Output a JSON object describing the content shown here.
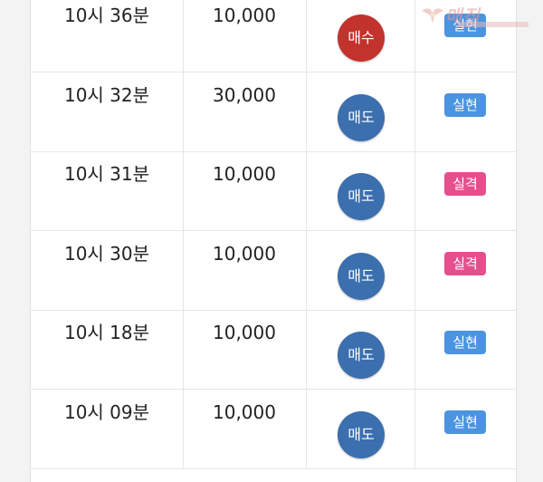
{
  "colors": {
    "sell": "#3b6fae",
    "buy": "#c2332e",
    "realized": "#4a94e0",
    "failed": "#e44f8c"
  },
  "watermark": {
    "text": "매직"
  },
  "rows": [
    {
      "time": "10시 36분",
      "amount": "10,000",
      "trade": "매수",
      "trade_type": "buy",
      "result": "실현",
      "result_type": "realized"
    },
    {
      "time": "10시 32분",
      "amount": "30,000",
      "trade": "매도",
      "trade_type": "sell",
      "result": "실현",
      "result_type": "realized"
    },
    {
      "time": "10시 31분",
      "amount": "10,000",
      "trade": "매도",
      "trade_type": "sell",
      "result": "실격",
      "result_type": "failed"
    },
    {
      "time": "10시 30분",
      "amount": "10,000",
      "trade": "매도",
      "trade_type": "sell",
      "result": "실격",
      "result_type": "failed"
    },
    {
      "time": "10시 18분",
      "amount": "10,000",
      "trade": "매도",
      "trade_type": "sell",
      "result": "실현",
      "result_type": "realized"
    },
    {
      "time": "10시 09분",
      "amount": "10,000",
      "trade": "매도",
      "trade_type": "sell",
      "result": "실현",
      "result_type": "realized"
    }
  ]
}
